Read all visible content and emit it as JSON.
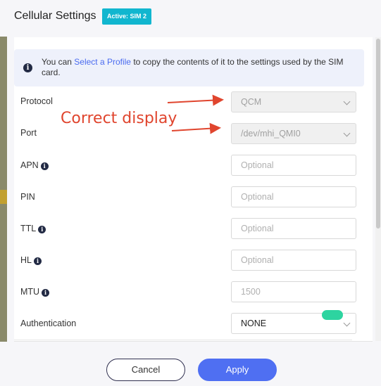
{
  "dialog": {
    "title": "Cellular Settings",
    "badge": "Active: SIM 2"
  },
  "info": {
    "icon": "info-icon",
    "prefix": "You can ",
    "link": "Select a Profile",
    "suffix": " to copy the contents of it to the settings used by the SIM card."
  },
  "annotation": {
    "text": "Correct display",
    "color": "#e0452e"
  },
  "fields": {
    "protocol": {
      "label": "Protocol",
      "value": "QCM"
    },
    "port": {
      "label": "Port",
      "value": "/dev/mhi_QMI0"
    },
    "apn": {
      "label": "APN",
      "placeholder": "Optional"
    },
    "pin": {
      "label": "PIN",
      "placeholder": "Optional"
    },
    "ttl": {
      "label": "TTL",
      "placeholder": "Optional"
    },
    "hl": {
      "label": "HL",
      "placeholder": "Optional"
    },
    "mtu": {
      "label": "MTU",
      "placeholder": "1500"
    },
    "authentication": {
      "label": "Authentication",
      "value": "NONE"
    }
  },
  "toggle": {
    "on": true
  },
  "footer": {
    "cancel": "Cancel",
    "apply": "Apply"
  },
  "colors": {
    "accent": "#4f6ff2",
    "badge": "#11b6cf",
    "toggle": "#2dd4a0"
  }
}
